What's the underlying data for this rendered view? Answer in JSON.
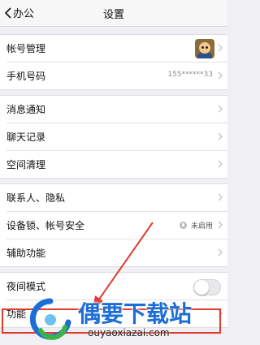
{
  "nav": {
    "back_label": "办公",
    "title": "设置"
  },
  "group1": {
    "account": "帐号管理",
    "phone": "手机号码",
    "phone_value": "155******33"
  },
  "group2": {
    "notifications": "消息通知",
    "chat_history": "聊天记录",
    "storage": "空间清理"
  },
  "group3": {
    "contacts_privacy": "联系人、隐私",
    "device_lock": "设备锁、帐号安全",
    "device_lock_status": "未启用",
    "accessibility": "辅助功能"
  },
  "group4": {
    "night_mode": "夜间模式",
    "night_mode_on": false,
    "features": "功能"
  },
  "watermark": {
    "name": "偶要下载站",
    "url": "ouyaoxiazai.com"
  },
  "colors": {
    "highlight": "#e23b2e",
    "watermark": "#1c6ed6"
  }
}
